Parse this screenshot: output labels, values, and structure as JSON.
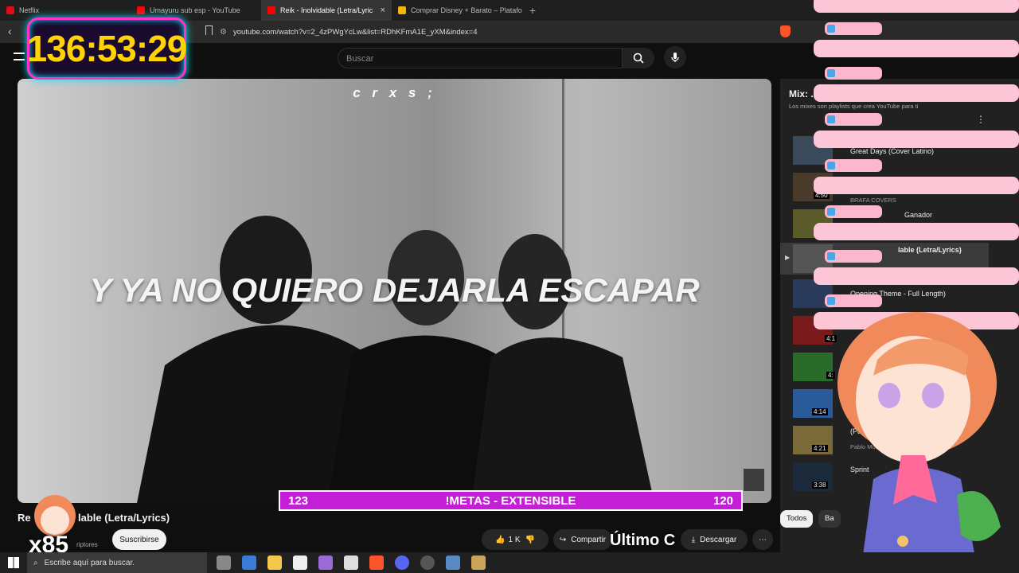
{
  "browser": {
    "tabs": [
      {
        "label": "Netflix",
        "color": "#e50914"
      },
      {
        "label": "Umayuru sub esp - YouTube",
        "color": "#ff0000"
      },
      {
        "label": "Reik - Inolvidable (Letra/Lyric",
        "color": "#ff0000",
        "active": true
      },
      {
        "label": "Comprar Disney + Barato – Plataform",
        "color": "#f2b705"
      }
    ],
    "url": "youtube.com/watch?v=2_4zPWgYcLw&list=RDhKFmA1E_yXM&index=4"
  },
  "youtube": {
    "search_placeholder": "Buscar",
    "video": {
      "overlay_tag": "c r x s ;",
      "lyric": "Y YA NO QUIERO DEJARLA ESCAPAR",
      "title_partial": "Re",
      "title_rest": "lable (Letra/Lyrics)",
      "subscribers_partial": "riptores",
      "subscribe_label": "Suscribirse",
      "likes": "1 K",
      "share_label": "Compartir",
      "download_label": "Descargar"
    },
    "mix": {
      "title": "Mix: ...",
      "subtitle": "Los mixes son playlists que crea YouTube para ti",
      "items": [
        {
          "title": "Great Days (Cover Latino)",
          "channel": "",
          "duration": ""
        },
        {
          "title": "",
          "channel": "BRAFA COVERS",
          "duration": "4:50"
        },
        {
          "title": "Ganador",
          "channel": "",
          "duration": ""
        },
        {
          "title": "lable (Letra/Lyrics)",
          "channel": "",
          "duration": "",
          "playing": true
        },
        {
          "title": "Opening Theme - Full Length)",
          "channel": "",
          "duration": ""
        },
        {
          "title": "",
          "channel": "",
          "duration": "4:1"
        },
        {
          "title": "",
          "channel": "",
          "duration": "4:"
        },
        {
          "title": "",
          "channel": "",
          "duration": "4:14"
        },
        {
          "title": "(Pa... de",
          "channel": "Pablo More",
          "duration": "4:21"
        },
        {
          "title": "Sprint",
          "channel": "",
          "duration": "3:38"
        }
      ],
      "chips": [
        "Todos",
        "Ba"
      ]
    }
  },
  "stream_overlay": {
    "timer": "136:53:29",
    "goal_left": "123",
    "goal_label": "!METAS - EXTENSIBLE",
    "goal_right": "120",
    "combo": "x85",
    "last_label": "Último C"
  },
  "taskbar": {
    "search_placeholder": "Escribe aquí para buscar."
  }
}
